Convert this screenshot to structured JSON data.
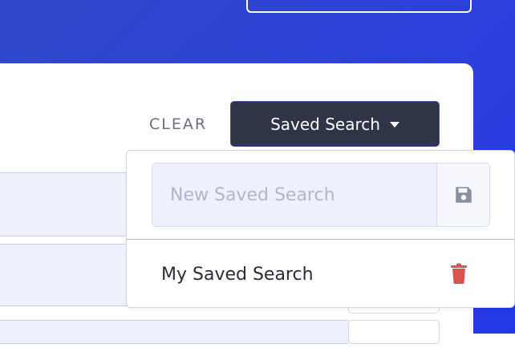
{
  "header": {
    "clear_label": "CLEAR",
    "saved_search_label": "Saved Search"
  },
  "dropdown": {
    "new_search_placeholder": "New Saved Search",
    "new_search_value": "",
    "saved_items": [
      {
        "label": "My Saved Search"
      }
    ]
  },
  "icons": {
    "save": "floppy-disk-icon",
    "delete": "trash-icon",
    "caret": "caret-down-icon"
  },
  "colors": {
    "background_gradient_start": "#2f49c9",
    "background_gradient_end": "#2437e6",
    "button_dark": "#2f3547",
    "delete_red": "#d9534f",
    "save_icon_gray": "#8a90a0"
  }
}
